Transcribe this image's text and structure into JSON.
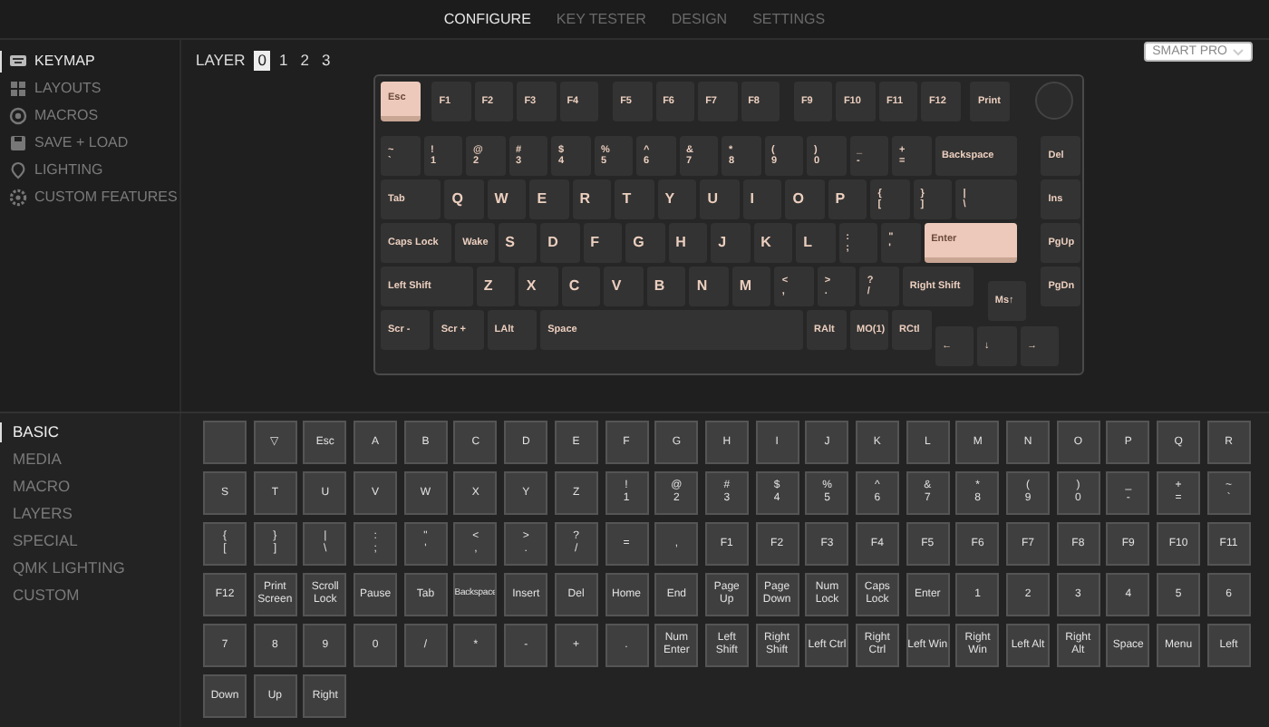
{
  "nav": [
    {
      "label": "CONFIGURE",
      "selected": true
    },
    {
      "label": "KEY TESTER",
      "selected": false
    },
    {
      "label": "DESIGN",
      "selected": false
    },
    {
      "label": "SETTINGS",
      "selected": false
    }
  ],
  "device_dropdown": {
    "label": "SMART PRO"
  },
  "sidebar": {
    "items": [
      {
        "label": "KEYMAP",
        "selected": true
      },
      {
        "label": "LAYOUTS",
        "selected": false
      },
      {
        "label": "MACROS",
        "selected": false
      },
      {
        "label": "SAVE + LOAD",
        "selected": false
      },
      {
        "label": "LIGHTING",
        "selected": false
      },
      {
        "label": "CUSTOM FEATURES",
        "selected": false
      }
    ]
  },
  "layers": {
    "label": "LAYER",
    "items": [
      {
        "label": "0",
        "selected": true
      },
      {
        "label": "1",
        "selected": false
      },
      {
        "label": "2",
        "selected": false
      },
      {
        "label": "3",
        "selected": false
      }
    ]
  },
  "keyboard": {
    "keys": [
      {
        "legend": [
          "Esc"
        ],
        "selected": true
      },
      {
        "legend": [
          "F1"
        ],
        "selected": false
      },
      {
        "legend": [
          "F2"
        ],
        "selected": false
      },
      {
        "legend": [
          "F3"
        ],
        "selected": false
      },
      {
        "legend": [
          "F4"
        ],
        "selected": false
      },
      {
        "legend": [
          "F5"
        ],
        "selected": false
      },
      {
        "legend": [
          "F6"
        ],
        "selected": false
      },
      {
        "legend": [
          "F7"
        ],
        "selected": false
      },
      {
        "legend": [
          "F8"
        ],
        "selected": false
      },
      {
        "legend": [
          "F9"
        ],
        "selected": false
      },
      {
        "legend": [
          "F10"
        ],
        "selected": false
      },
      {
        "legend": [
          "F11"
        ],
        "selected": false
      },
      {
        "legend": [
          "F12"
        ],
        "selected": false
      },
      {
        "legend": [
          "Print"
        ],
        "selected": false
      },
      {
        "legend": [
          "~",
          "`"
        ],
        "selected": false
      },
      {
        "legend": [
          "!",
          "1"
        ],
        "selected": false
      },
      {
        "legend": [
          "@",
          "2"
        ],
        "selected": false
      },
      {
        "legend": [
          "#",
          "3"
        ],
        "selected": false
      },
      {
        "legend": [
          "$",
          "4"
        ],
        "selected": false
      },
      {
        "legend": [
          "%",
          "5"
        ],
        "selected": false
      },
      {
        "legend": [
          "^",
          "6"
        ],
        "selected": false
      },
      {
        "legend": [
          "&",
          "7"
        ],
        "selected": false
      },
      {
        "legend": [
          "*",
          "8"
        ],
        "selected": false
      },
      {
        "legend": [
          "(",
          "9"
        ],
        "selected": false
      },
      {
        "legend": [
          ")",
          "0"
        ],
        "selected": false
      },
      {
        "legend": [
          "_",
          "-"
        ],
        "selected": false
      },
      {
        "legend": [
          "+",
          "="
        ],
        "selected": false
      },
      {
        "legend": [
          "Backspace"
        ],
        "selected": false
      },
      {
        "legend": [
          "Del"
        ],
        "selected": false
      },
      {
        "legend": [
          "Tab"
        ],
        "selected": false
      },
      {
        "legend": [
          "Q"
        ],
        "selected": false
      },
      {
        "legend": [
          "W"
        ],
        "selected": false
      },
      {
        "legend": [
          "E"
        ],
        "selected": false
      },
      {
        "legend": [
          "R"
        ],
        "selected": false
      },
      {
        "legend": [
          "T"
        ],
        "selected": false
      },
      {
        "legend": [
          "Y"
        ],
        "selected": false
      },
      {
        "legend": [
          "U"
        ],
        "selected": false
      },
      {
        "legend": [
          "I"
        ],
        "selected": false
      },
      {
        "legend": [
          "O"
        ],
        "selected": false
      },
      {
        "legend": [
          "P"
        ],
        "selected": false
      },
      {
        "legend": [
          "{",
          "["
        ],
        "selected": false
      },
      {
        "legend": [
          "}",
          "]"
        ],
        "selected": false
      },
      {
        "legend": [
          "|",
          "\\"
        ],
        "selected": false
      },
      {
        "legend": [
          "Ins"
        ],
        "selected": false
      },
      {
        "legend": [
          "Caps Lock"
        ],
        "selected": false
      },
      {
        "legend": [
          "Wake"
        ],
        "selected": false
      },
      {
        "legend": [
          "S"
        ],
        "selected": false
      },
      {
        "legend": [
          "D"
        ],
        "selected": false
      },
      {
        "legend": [
          "F"
        ],
        "selected": false
      },
      {
        "legend": [
          "G"
        ],
        "selected": false
      },
      {
        "legend": [
          "H"
        ],
        "selected": false
      },
      {
        "legend": [
          "J"
        ],
        "selected": false
      },
      {
        "legend": [
          "K"
        ],
        "selected": false
      },
      {
        "legend": [
          "L"
        ],
        "selected": false
      },
      {
        "legend": [
          ":",
          ";"
        ],
        "selected": false
      },
      {
        "legend": [
          "\"",
          "'"
        ],
        "selected": false
      },
      {
        "legend": [
          "Enter"
        ],
        "selected": true
      },
      {
        "legend": [
          "PgUp"
        ],
        "selected": false
      },
      {
        "legend": [
          "Left Shift"
        ],
        "selected": false
      },
      {
        "legend": [
          "Z"
        ],
        "selected": false
      },
      {
        "legend": [
          "X"
        ],
        "selected": false
      },
      {
        "legend": [
          "C"
        ],
        "selected": false
      },
      {
        "legend": [
          "V"
        ],
        "selected": false
      },
      {
        "legend": [
          "B"
        ],
        "selected": false
      },
      {
        "legend": [
          "N"
        ],
        "selected": false
      },
      {
        "legend": [
          "M"
        ],
        "selected": false
      },
      {
        "legend": [
          "<",
          ","
        ],
        "selected": false
      },
      {
        "legend": [
          ">",
          "."
        ],
        "selected": false
      },
      {
        "legend": [
          "?",
          "/"
        ],
        "selected": false
      },
      {
        "legend": [
          "Right Shift"
        ],
        "selected": false
      },
      {
        "legend": [
          "Ms↑"
        ],
        "selected": false
      },
      {
        "legend": [
          "PgDn"
        ],
        "selected": false
      },
      {
        "legend": [
          "Scr -"
        ],
        "selected": false
      },
      {
        "legend": [
          "Scr +"
        ],
        "selected": false
      },
      {
        "legend": [
          "LAlt"
        ],
        "selected": false
      },
      {
        "legend": [
          "Space"
        ],
        "selected": false
      },
      {
        "legend": [
          "RAlt"
        ],
        "selected": false
      },
      {
        "legend": [
          "MO(1)"
        ],
        "selected": false
      },
      {
        "legend": [
          "RCtl"
        ],
        "selected": false
      },
      {
        "legend": [
          "←"
        ],
        "selected": false
      },
      {
        "legend": [
          "↓"
        ],
        "selected": false
      },
      {
        "legend": [
          "→"
        ],
        "selected": false
      }
    ]
  },
  "categories": [
    {
      "label": "BASIC",
      "selected": true
    },
    {
      "label": "MEDIA",
      "selected": false
    },
    {
      "label": "MACRO",
      "selected": false
    },
    {
      "label": "LAYERS",
      "selected": false
    },
    {
      "label": "SPECIAL",
      "selected": false
    },
    {
      "label": "QMK LIGHTING",
      "selected": false
    },
    {
      "label": "CUSTOM",
      "selected": false
    }
  ],
  "keycodes": [
    [
      "▽"
    ],
    [
      "Esc"
    ],
    [
      "A"
    ],
    [
      "B"
    ],
    [
      "C"
    ],
    [
      "D"
    ],
    [
      "E"
    ],
    [
      "F"
    ],
    [
      "G"
    ],
    [
      "H"
    ],
    [
      "I"
    ],
    [
      "J"
    ],
    [
      "K"
    ],
    [
      "L"
    ],
    [
      "M"
    ],
    [
      "N"
    ],
    [
      "O"
    ],
    [
      "P"
    ],
    [
      "Q"
    ],
    [
      "R"
    ],
    [
      "S"
    ],
    [
      "T"
    ],
    [
      "U"
    ],
    [
      "V"
    ],
    [
      "W"
    ],
    [
      "X"
    ],
    [
      "Y"
    ],
    [
      "Z"
    ],
    [
      "!",
      "1"
    ],
    [
      "@",
      "2"
    ],
    [
      "#",
      "3"
    ],
    [
      "$",
      "4"
    ],
    [
      "%",
      "5"
    ],
    [
      "^",
      "6"
    ],
    [
      "&",
      "7"
    ],
    [
      "*",
      "8"
    ],
    [
      "(",
      "9"
    ],
    [
      ")",
      "0"
    ],
    [
      "_",
      "-"
    ],
    [
      "+",
      "="
    ],
    [
      "~",
      "`"
    ],
    [
      "{",
      "["
    ],
    [
      "}",
      "]"
    ],
    [
      "|",
      "\\"
    ],
    [
      ":",
      ";"
    ],
    [
      "\"",
      "'"
    ],
    [
      "<",
      ","
    ],
    [
      ">",
      "."
    ],
    [
      "?",
      "/"
    ],
    [
      "="
    ],
    [
      ","
    ],
    [
      "F1"
    ],
    [
      "F2"
    ],
    [
      "F3"
    ],
    [
      "F4"
    ],
    [
      "F5"
    ],
    [
      "F6"
    ],
    [
      "F7"
    ],
    [
      "F8"
    ],
    [
      "F9"
    ],
    [
      "F10"
    ],
    [
      "F11"
    ],
    [
      "F12"
    ],
    [
      "Print Screen"
    ],
    [
      "Scroll Lock"
    ],
    [
      "Pause"
    ],
    [
      "Tab"
    ],
    [
      "Backspace"
    ],
    [
      "Insert"
    ],
    [
      "Del"
    ],
    [
      "Home"
    ],
    [
      "End"
    ],
    [
      "Page Up"
    ],
    [
      "Page Down"
    ],
    [
      "Num Lock"
    ],
    [
      "Caps Lock"
    ],
    [
      "Enter"
    ],
    [
      "1"
    ],
    [
      "2"
    ],
    [
      "3"
    ],
    [
      "4"
    ],
    [
      "5"
    ],
    [
      "6"
    ],
    [
      "7"
    ],
    [
      "8"
    ],
    [
      "9"
    ],
    [
      "0"
    ],
    [
      "/"
    ],
    [
      "*"
    ],
    [
      "-"
    ],
    [
      "+"
    ],
    [
      "."
    ],
    [
      "Num Enter"
    ],
    [
      "Left Shift"
    ],
    [
      "Right Shift"
    ],
    [
      "Left Ctrl"
    ],
    [
      "Right Ctrl"
    ],
    [
      "Left Win"
    ],
    [
      "Right Win"
    ],
    [
      "Left Alt"
    ],
    [
      "Right Alt"
    ],
    [
      "Space"
    ],
    [
      "Menu"
    ],
    [
      "Left"
    ],
    [
      "Down"
    ],
    [
      "Up"
    ],
    [
      "Right"
    ]
  ]
}
